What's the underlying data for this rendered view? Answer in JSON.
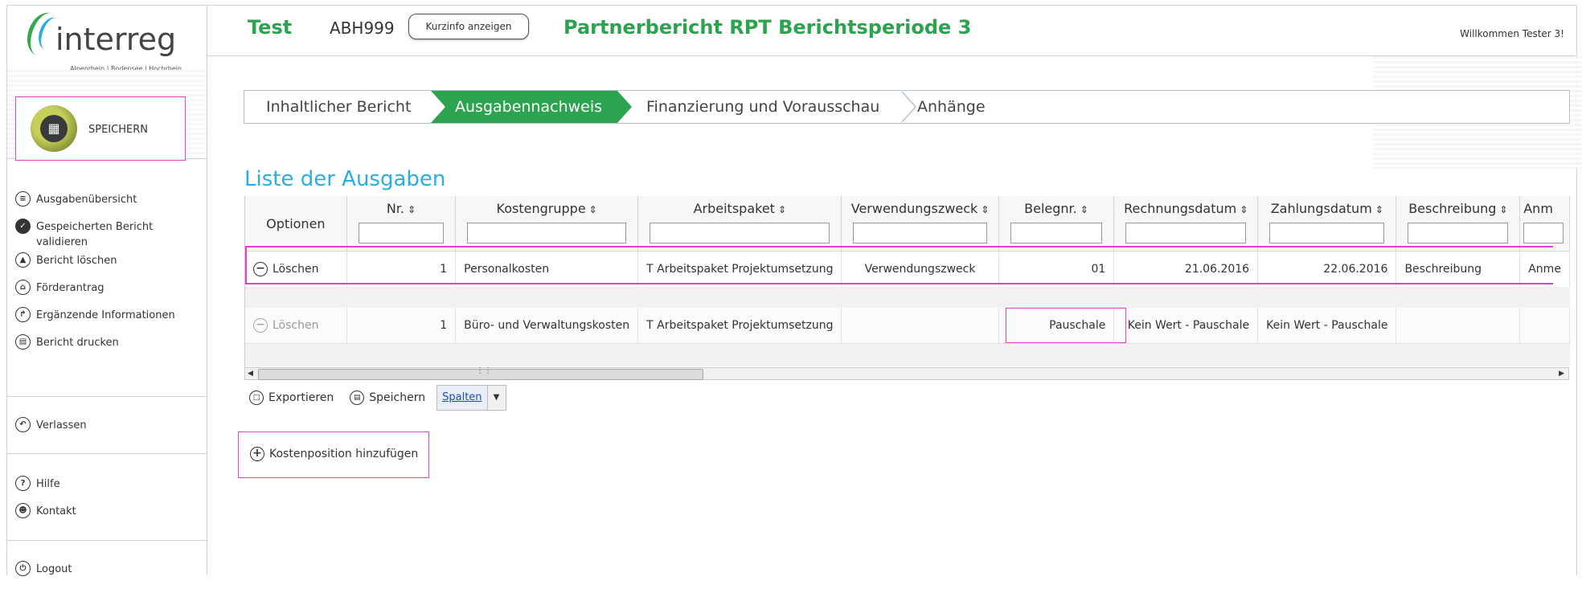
{
  "header": {
    "project_short": "Test",
    "project_code": "ABH999",
    "kurzinfo_button": "Kurzinfo anzeigen",
    "report_title": "Partnerbericht RPT Berichtsperiode 3",
    "welcome": "Willkommen Tester 3!"
  },
  "logo": {
    "name": "interreg",
    "subtitle": "Alpenrhein | Bodensee | Hochrhein"
  },
  "sidebar": {
    "save_label": "SPEICHERN",
    "items": [
      {
        "label": "Ausgabenübersicht",
        "icon": "list-icon"
      },
      {
        "label": "Gespeicherten Bericht validieren",
        "icon": "check-icon"
      },
      {
        "label": "Bericht löschen",
        "icon": "trash-icon"
      },
      {
        "label": "Förderantrag",
        "icon": "bank-icon"
      },
      {
        "label": "Ergänzende Informationen",
        "icon": "corner-arrow-icon"
      },
      {
        "label": "Bericht drucken",
        "icon": "printer-icon"
      }
    ],
    "leave": "Verlassen",
    "help": "Hilfe",
    "contact": "Kontakt",
    "logout": "Logout"
  },
  "tabs": [
    {
      "label": "Inhaltlicher Bericht",
      "active": false
    },
    {
      "label": "Ausgabennachweis",
      "active": true
    },
    {
      "label": "Finanzierung und Vorausschau",
      "active": false
    },
    {
      "label": "Anhänge",
      "active": false
    }
  ],
  "list": {
    "title": "Liste der Ausgaben",
    "columns": [
      "Optionen",
      "Nr.",
      "Kostengruppe",
      "Arbeitspaket",
      "Verwendungszweck",
      "Belegnr.",
      "Rechnungsdatum",
      "Zahlungsdatum",
      "Beschreibung",
      "Anm"
    ],
    "rows": [
      {
        "option": "Löschen",
        "nr": "1",
        "kostengruppe": "Personalkosten",
        "arbeitspaket": "T Arbeitspaket Projektumsetzung",
        "verwendungszweck": "Verwendungszweck",
        "belegnr": "01",
        "rechnungsdatum": "21.06.2016",
        "zahlungsdatum": "22.06.2016",
        "beschreibung": "Beschreibung",
        "anm": "Anme"
      },
      {
        "option": "Löschen",
        "nr": "1",
        "kostengruppe": "Büro- und Verwaltungskosten",
        "arbeitspaket": "T Arbeitspaket Projektumsetzung",
        "verwendungszweck": "",
        "belegnr": "Pauschale",
        "rechnungsdatum": "Kein Wert - Pauschale",
        "zahlungsdatum": "Kein Wert - Pauschale",
        "beschreibung": "",
        "anm": ""
      }
    ]
  },
  "toolbar": {
    "export": "Exportieren",
    "save": "Speichern",
    "columns": "Spalten"
  },
  "add_cost_position": "Kostenposition hinzufügen",
  "colors": {
    "brand_green": "#2ca34f",
    "accent_blue": "#29aee3",
    "highlight_magenta": "#e43fd0"
  }
}
